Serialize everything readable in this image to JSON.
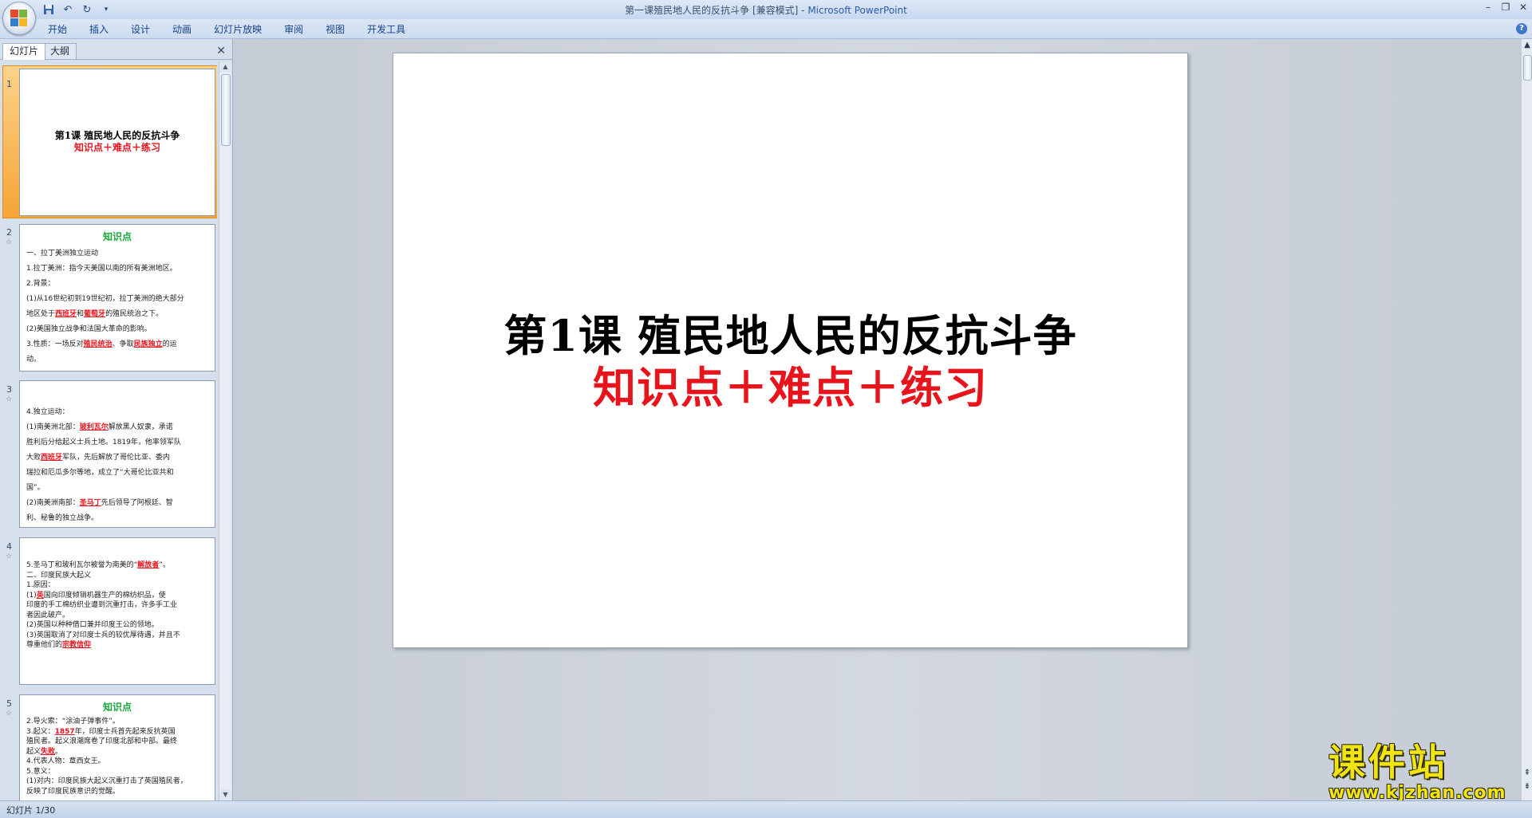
{
  "window": {
    "title_doc": "第一课殖民地人民的反抗斗争 [兼容模式]",
    "title_sep": " - ",
    "title_app": "Microsoft PowerPoint"
  },
  "ribbon": {
    "tabs": [
      "开始",
      "插入",
      "设计",
      "动画",
      "幻灯片放映",
      "审阅",
      "视图",
      "开发工具"
    ]
  },
  "pane": {
    "tab_slides": "幻灯片",
    "tab_outline": "大纲"
  },
  "thumbnails": {
    "t1": {
      "num": "1",
      "title": "第1课  殖民地人民的反抗斗争",
      "subtitle": "知识点＋难点＋练习"
    },
    "t2": {
      "num": "2",
      "head": "知识点",
      "l1": "一、拉丁美洲独立运动",
      "l2": "1.拉丁美洲：指今天美国以南的所有美洲地区。",
      "l3": "2.背景：",
      "l4": "(1)从16世纪初到19世纪初，拉丁美洲的绝大部分",
      "l5a": "地区处于",
      "l5b": "西班牙",
      "l5c": "和",
      "l5d": "葡萄牙",
      "l5e": "的殖民统治之下。",
      "l6": "(2)美国独立战争和法国大革命的影响。",
      "l7a": "3.性质：一场反对",
      "l7b": "殖民统治",
      "l7c": "、争取",
      "l7d": "民族独立",
      "l7e": "的运",
      "l8": "动。"
    },
    "t3": {
      "num": "3",
      "l1": "4.独立运动：",
      "l2a": "(1)南美洲北部：",
      "l2b": "玻利瓦尔",
      "l2c": "解放黑人奴隶，承诺",
      "l3": "胜利后分给起义士兵土地。1819年，他率领军队",
      "l4a": "大败",
      "l4b": "西班牙",
      "l4c": "军队，先后解放了哥伦比亚、委内",
      "l5": "瑞拉和厄瓜多尔等地，成立了“大哥伦比亚共和",
      "l6": "国”。",
      "l7a": "(2)南美洲南部：",
      "l7b": "圣马丁",
      "l7c": "先后领导了阿根廷、智",
      "l8": "利、秘鲁的独立战争。"
    },
    "t4": {
      "num": "4",
      "l1a": "5.圣马丁和玻利瓦尔被誉为南美的“",
      "l1b": "解放者",
      "l1c": "”。",
      "l2": "二、印度民族大起义",
      "l3": "1.原因：",
      "l4a": "(1)",
      "l4b": "英",
      "l4c": "国向印度倾销机器生产的棉纺织品，使",
      "l5": "印度的手工棉纺织业遭到沉重打击，许多手工业",
      "l6": "者因此破产。",
      "l7": "(2)英国以种种借口兼并印度王公的领地。",
      "l8": "(3)英国取消了对印度士兵的较优厚待遇，并且不",
      "l9a": "尊重他们的",
      "l9b": "宗教信仰"
    },
    "t5": {
      "num": "5",
      "head": "知识点",
      "l1": "2.导火索：“涂油子弹事件”。",
      "l2a": "3.起义：",
      "l2b": "1857",
      "l2c": "年，印度士兵首先起来反抗英国",
      "l3": "殖民者。起义浪潮席卷了印度北部和中部。最终",
      "l4a": "起义",
      "l4b": "失败",
      "l4c": "。",
      "l5": "4.代表人物：章西女王。",
      "l6": "5.意义：",
      "l7": "(1)对内：印度民族大起义沉重打击了英国殖民者，",
      "l8": "反映了印度民族意识的觉醒。"
    }
  },
  "slide": {
    "title": "第1课  殖民地人民的反抗斗争",
    "subtitle": "知识点＋难点＋练习"
  },
  "status": {
    "text": "幻灯片 1/30"
  },
  "watermark": {
    "cn": "课件站",
    "url": "www.kjzhan.com"
  },
  "colors": {
    "accent_red": "#e8141c",
    "heading_green": "#18a83a",
    "selected_thumb": "#f6a436"
  }
}
